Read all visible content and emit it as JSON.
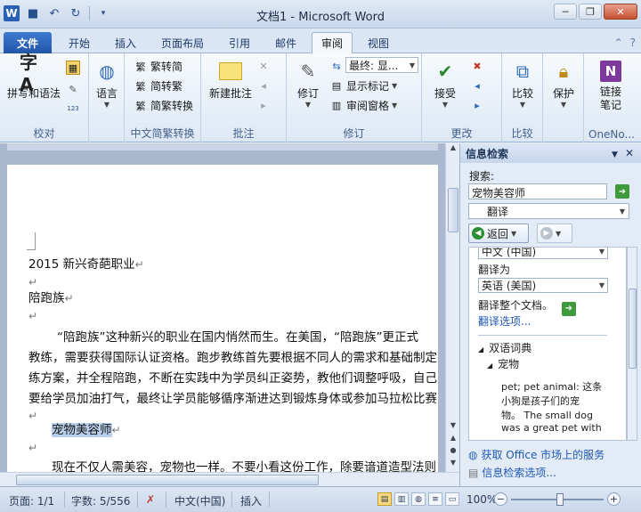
{
  "window": {
    "title": "文档1 - Microsoft Word"
  },
  "qat": {
    "logo": "W"
  },
  "tabs": [
    {
      "label": "文件"
    },
    {
      "label": "开始"
    },
    {
      "label": "插入"
    },
    {
      "label": "页面布局"
    },
    {
      "label": "引用"
    },
    {
      "label": "邮件"
    },
    {
      "label": "审阅"
    },
    {
      "label": "视图"
    }
  ],
  "ribbon": {
    "groups": {
      "proofing": "校对",
      "chinese_conv": "中文简繁转换",
      "comments": "批注",
      "tracking": "修订",
      "changes": "更改",
      "compare": "比较",
      "onenote": "OneNo..."
    },
    "buttons": {
      "spelling": "拼写和语法",
      "language": "语言",
      "trad_to_simp": "繁转简",
      "simp_to_trad": "简转繁",
      "conversion": "简繁转换",
      "new_comment": "新建批注",
      "track_changes": "修订",
      "final_show": "最终: 显...",
      "show_markup": "显示标记",
      "review_pane": "审阅窗格",
      "accept": "接受",
      "compare": "比较",
      "protect": "保护",
      "linked_notes": "链接笔记"
    }
  },
  "document": {
    "lines": [
      "2015 新兴奇葩职业",
      "陪跑族",
      "“陪跑族”这种新兴的职业在国内悄然而生。在美国，“陪跑族”更正式",
      "教练，需要获得国际认证资格。跑步教练首先要根据不同人的需求和基础制定",
      "练方案，并全程陪跑，不断在实践中为学员纠正姿势，教他们调整呼吸，自己",
      "要给学员加油打气，最终让学员能够循序渐进达到锻炼身体或参加马拉松比赛",
      "宠物美容师",
      "现在不仅人需美容，宠物也一样。不要小看这份工作，除要谙道造型法则"
    ]
  },
  "research_pane": {
    "title": "信息检索",
    "search_label": "搜索:",
    "search_value": "宠物美容师",
    "service": "翻译",
    "back_label": "返回",
    "from_lang": "中文 (中国)",
    "translate_to_label": "翻译为",
    "to_lang": "英语 (美国)",
    "translate_doc": "翻译整个文档。",
    "translate_options": "翻译选项...",
    "bilingual_dict": "双语词典",
    "dict_headword": "宠物",
    "dict_lines": [
      "pet; pet animal: 这条",
      "小狗是孩子们的宠",
      "物。 The small dog",
      "was a great pet with"
    ],
    "office_market": "获取 Office 市场上的服务",
    "research_options": "信息检索选项..."
  },
  "statusbar": {
    "page": "页面: 1/1",
    "words": "字数: 5/556",
    "language": "中文(中国)",
    "mode": "插入",
    "zoom": "100%"
  }
}
